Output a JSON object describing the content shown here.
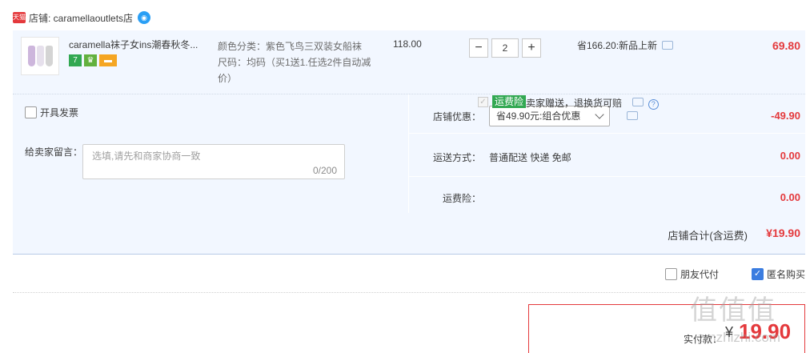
{
  "shop": {
    "platform_logo": "天猫",
    "label": "店铺: caramellaoutlets店",
    "chat_icon": "wangwang-chat-icon"
  },
  "item": {
    "title": "caramella袜子女ins潮春秋冬...",
    "badge_seven": "7",
    "badge_crown": "♛",
    "badge_card": "▬",
    "spec_color": "颜色分类：紫色飞鸟三双装女船袜",
    "spec_size": "尺码：均码（买1送1.任选2件自动减价）",
    "unit_price": "118.00",
    "quantity": "2",
    "minus_label": "−",
    "plus_label": "+",
    "promo_text": "省166.20:新品上新",
    "subtotal": "69.80"
  },
  "invoice": {
    "label": "开具发票",
    "checked": false
  },
  "note": {
    "label": "给卖家留言：",
    "placeholder": "选填,请先和商家协商一致",
    "counter": "0/200"
  },
  "discount": {
    "label": "店铺优惠：",
    "selected": "省49.90元:组合优惠",
    "amount": "-49.90"
  },
  "shipping": {
    "label": "运送方式：",
    "value": "普通配送 快递 免邮",
    "amount": "0.00"
  },
  "insurance": {
    "label": "运费险：",
    "tag": "运费险",
    "desc": "卖家赠送，退换货可赔",
    "amount": "0.00",
    "help_glyph": "?"
  },
  "shop_total": {
    "label": "店铺合计(含运费)",
    "value": "¥19.90"
  },
  "options": {
    "friend_pay": "朋友代付",
    "friend_pay_checked": false,
    "anonymous": "匿名购买",
    "anonymous_checked": true,
    "check_glyph": "✓"
  },
  "final": {
    "label": "实付款：",
    "symbol": "¥",
    "value": "19.90"
  },
  "watermark": {
    "main": "值值值",
    "sub": "zmzhizhi.com"
  },
  "colors": {
    "accent_red": "#e4393c",
    "panel_bg": "#f2f7ff",
    "green_tag": "#32a852",
    "blue_check": "#3b7de0"
  }
}
